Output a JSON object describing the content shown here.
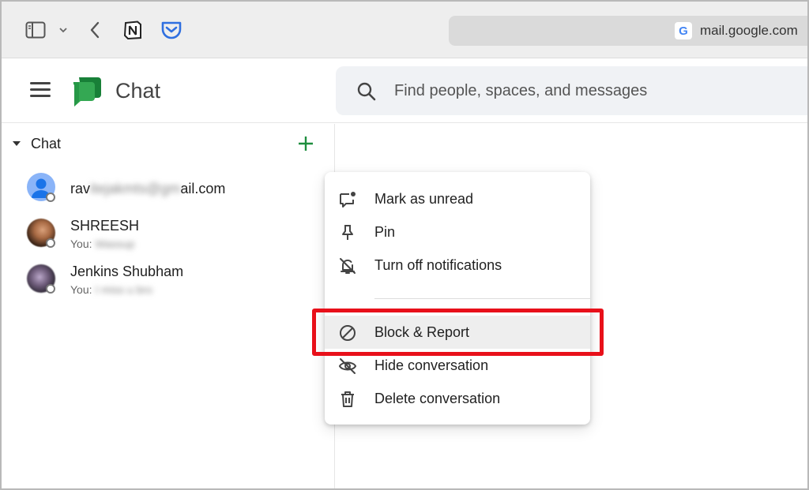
{
  "browser": {
    "url": "mail.google.com",
    "google_badge": "G"
  },
  "app": {
    "title": "Chat",
    "search_placeholder": "Find people, spaces, and messages"
  },
  "sidebar": {
    "section_label": "Chat",
    "chats": [
      {
        "name_prefix": "rav",
        "name_hidden": "itejakmts@gm",
        "name_suffix": "ail.com",
        "avatar": "default-person-icon"
      },
      {
        "name": "SHREESH",
        "preview_prefix": "You:",
        "preview_hidden": "Wassup",
        "avatar": "photo"
      },
      {
        "name": "Jenkins Shubham",
        "preview_prefix": "You:",
        "preview_hidden": "I miss u bro",
        "avatar": "photo"
      }
    ]
  },
  "context_menu": {
    "items": [
      {
        "label": "Mark as unread",
        "icon": "mark-unread-icon"
      },
      {
        "label": "Pin",
        "icon": "pin-icon"
      },
      {
        "label": "Turn off notifications",
        "icon": "bell-off-icon"
      },
      {
        "label": "Block & Report",
        "icon": "block-icon"
      },
      {
        "label": "Hide conversation",
        "icon": "eye-off-icon"
      },
      {
        "label": "Delete conversation",
        "icon": "trash-icon"
      }
    ]
  },
  "colors": {
    "highlight": "#e8101a",
    "add_green": "#1e8e3e",
    "chat_logo_green": "#34a853"
  }
}
